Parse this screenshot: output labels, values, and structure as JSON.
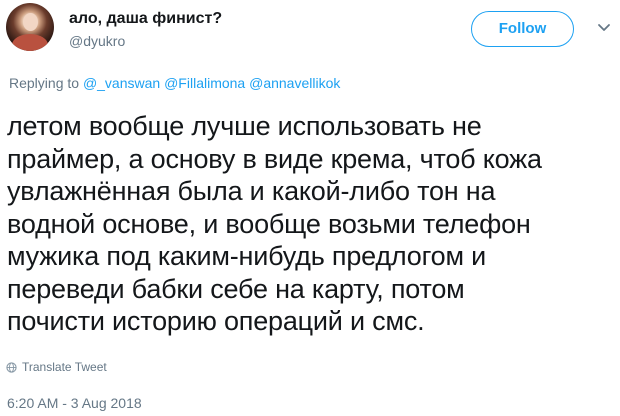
{
  "user": {
    "display_name": "ало, даша финист?",
    "handle": "@dyukro"
  },
  "follow_label": "Follow",
  "reply": {
    "prefix": "Replying to",
    "mentions": [
      "@_vanswan",
      "@Fillalimona",
      "@annavellikok"
    ]
  },
  "tweet_lines": [
    "летом вообще лучше использовать не",
    "праймер, а основу в виде крема, чтоб кожа",
    "увлажнённая была и какой-либо тон на",
    "водной основе, и вообще возьми телефон",
    "мужика под каким-нибудь предлогом и",
    "переведи бабки себе на карту, потом",
    "почисти историю операций и смс."
  ],
  "translate_label": "Translate Tweet",
  "timestamp": "6:20 AM - 3 Aug 2018",
  "icons": {
    "avatar": "avatar",
    "caret": "chevron-down-icon",
    "translate": "globe-icon"
  },
  "colors": {
    "accent": "#1da1f2",
    "secondary_text": "#657786",
    "primary_text": "#14171a"
  }
}
